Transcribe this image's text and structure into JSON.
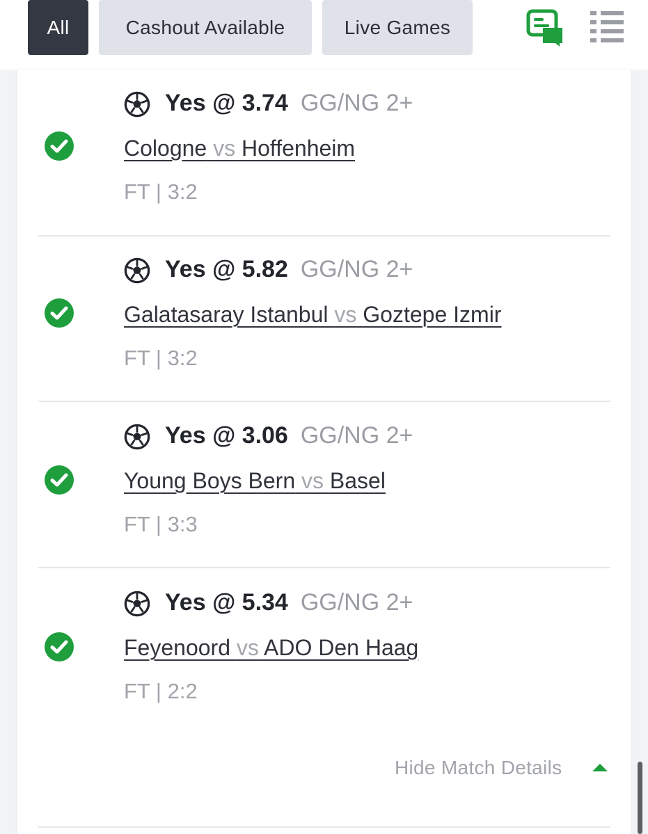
{
  "tabs": [
    {
      "label": "All",
      "active": true
    },
    {
      "label": "Cashout Available",
      "active": false
    },
    {
      "label": "Live Games",
      "active": false
    }
  ],
  "icons": {
    "chat": "chat-bubbles-icon",
    "menu": "list-menu-icon",
    "status": "check-circle-icon",
    "sport": "soccer-ball-icon"
  },
  "colors": {
    "accent_green": "#1f9e3e",
    "active_tab": "#333842"
  },
  "bets": [
    {
      "pick": "Yes @ 3.74",
      "market": "GG/NG 2+",
      "home": "Cologne",
      "vs": "vs",
      "away": "Hoffenheim",
      "result": "FT | 3:2"
    },
    {
      "pick": "Yes @ 5.82",
      "market": "GG/NG 2+",
      "home": "Galatasaray Istanbul",
      "vs": "vs",
      "away": "Goztepe Izmir",
      "result": "FT | 3:2"
    },
    {
      "pick": "Yes @ 3.06",
      "market": "GG/NG 2+",
      "home": "Young Boys Bern",
      "vs": "vs",
      "away": "Basel",
      "result": "FT | 3:3"
    },
    {
      "pick": "Yes @ 5.34",
      "market": "GG/NG 2+",
      "home": "Feyenoord",
      "vs": "vs",
      "away": "ADO Den Haag",
      "result": "FT | 2:2"
    }
  ],
  "hide_details_label": "Hide Match Details"
}
